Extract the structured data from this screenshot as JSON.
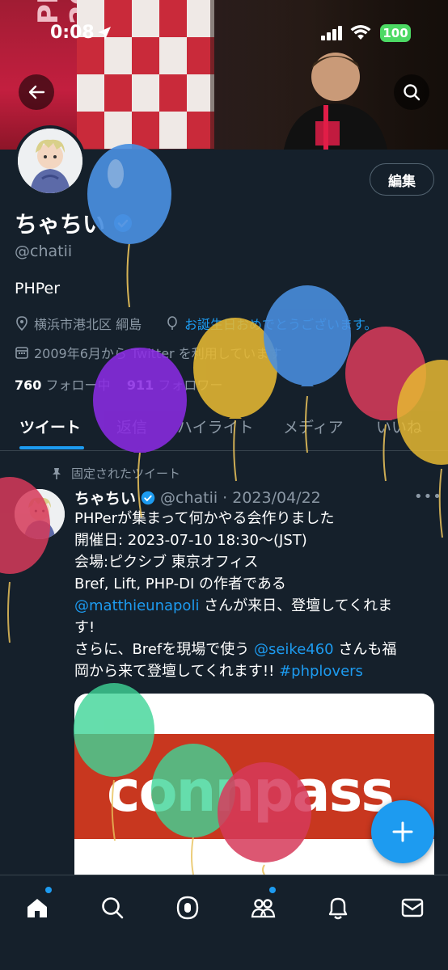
{
  "status_bar": {
    "time": "0:08",
    "battery": "100"
  },
  "profile": {
    "edit_label": "編集",
    "name": "ちゃちい",
    "handle": "@chatii",
    "bio": "PHPer",
    "location": "横浜市港北区 綱島",
    "birthday": "お誕生日おめでとうございます。",
    "joined": "2009年6月から Twitter を利用しています",
    "following_count": "760",
    "following_label": "フォロー中",
    "followers_count": "911",
    "followers_label": "フォロワー"
  },
  "tabs": [
    {
      "label": "ツイート"
    },
    {
      "label": "返信"
    },
    {
      "label": "ハイライト"
    },
    {
      "label": "メディア"
    },
    {
      "label": "いいね"
    }
  ],
  "tweet": {
    "pinned_label": "固定されたツイート",
    "author": "ちゃちい",
    "handle": "@chatii",
    "date": "· 2023/04/22",
    "lines": {
      "l1": "PHPerが集まって何かやる会作りました",
      "l2": "開催日: 2023-07-10 18:30～(JST)",
      "l3": "会場:ピクシブ 東京オフィス",
      "l4": "Bref, Lift, PHP-DI の作者である",
      "l5_mention": "@matthieunapoli",
      "l5_text": " さんが来日、登壇してくれま",
      "l6": "す!",
      "l7_text": "さらに、Brefを現場で使う ",
      "l7_mention": "@seike460",
      "l7_tail": " さんも福",
      "l8_text": "岡から来て登壇してくれます!! ",
      "l8_tag": "#phplovers"
    },
    "card_text": "connpass"
  },
  "colors": {
    "accent": "#1d9bf0",
    "background": "#15202b",
    "muted": "#8b98a5"
  }
}
